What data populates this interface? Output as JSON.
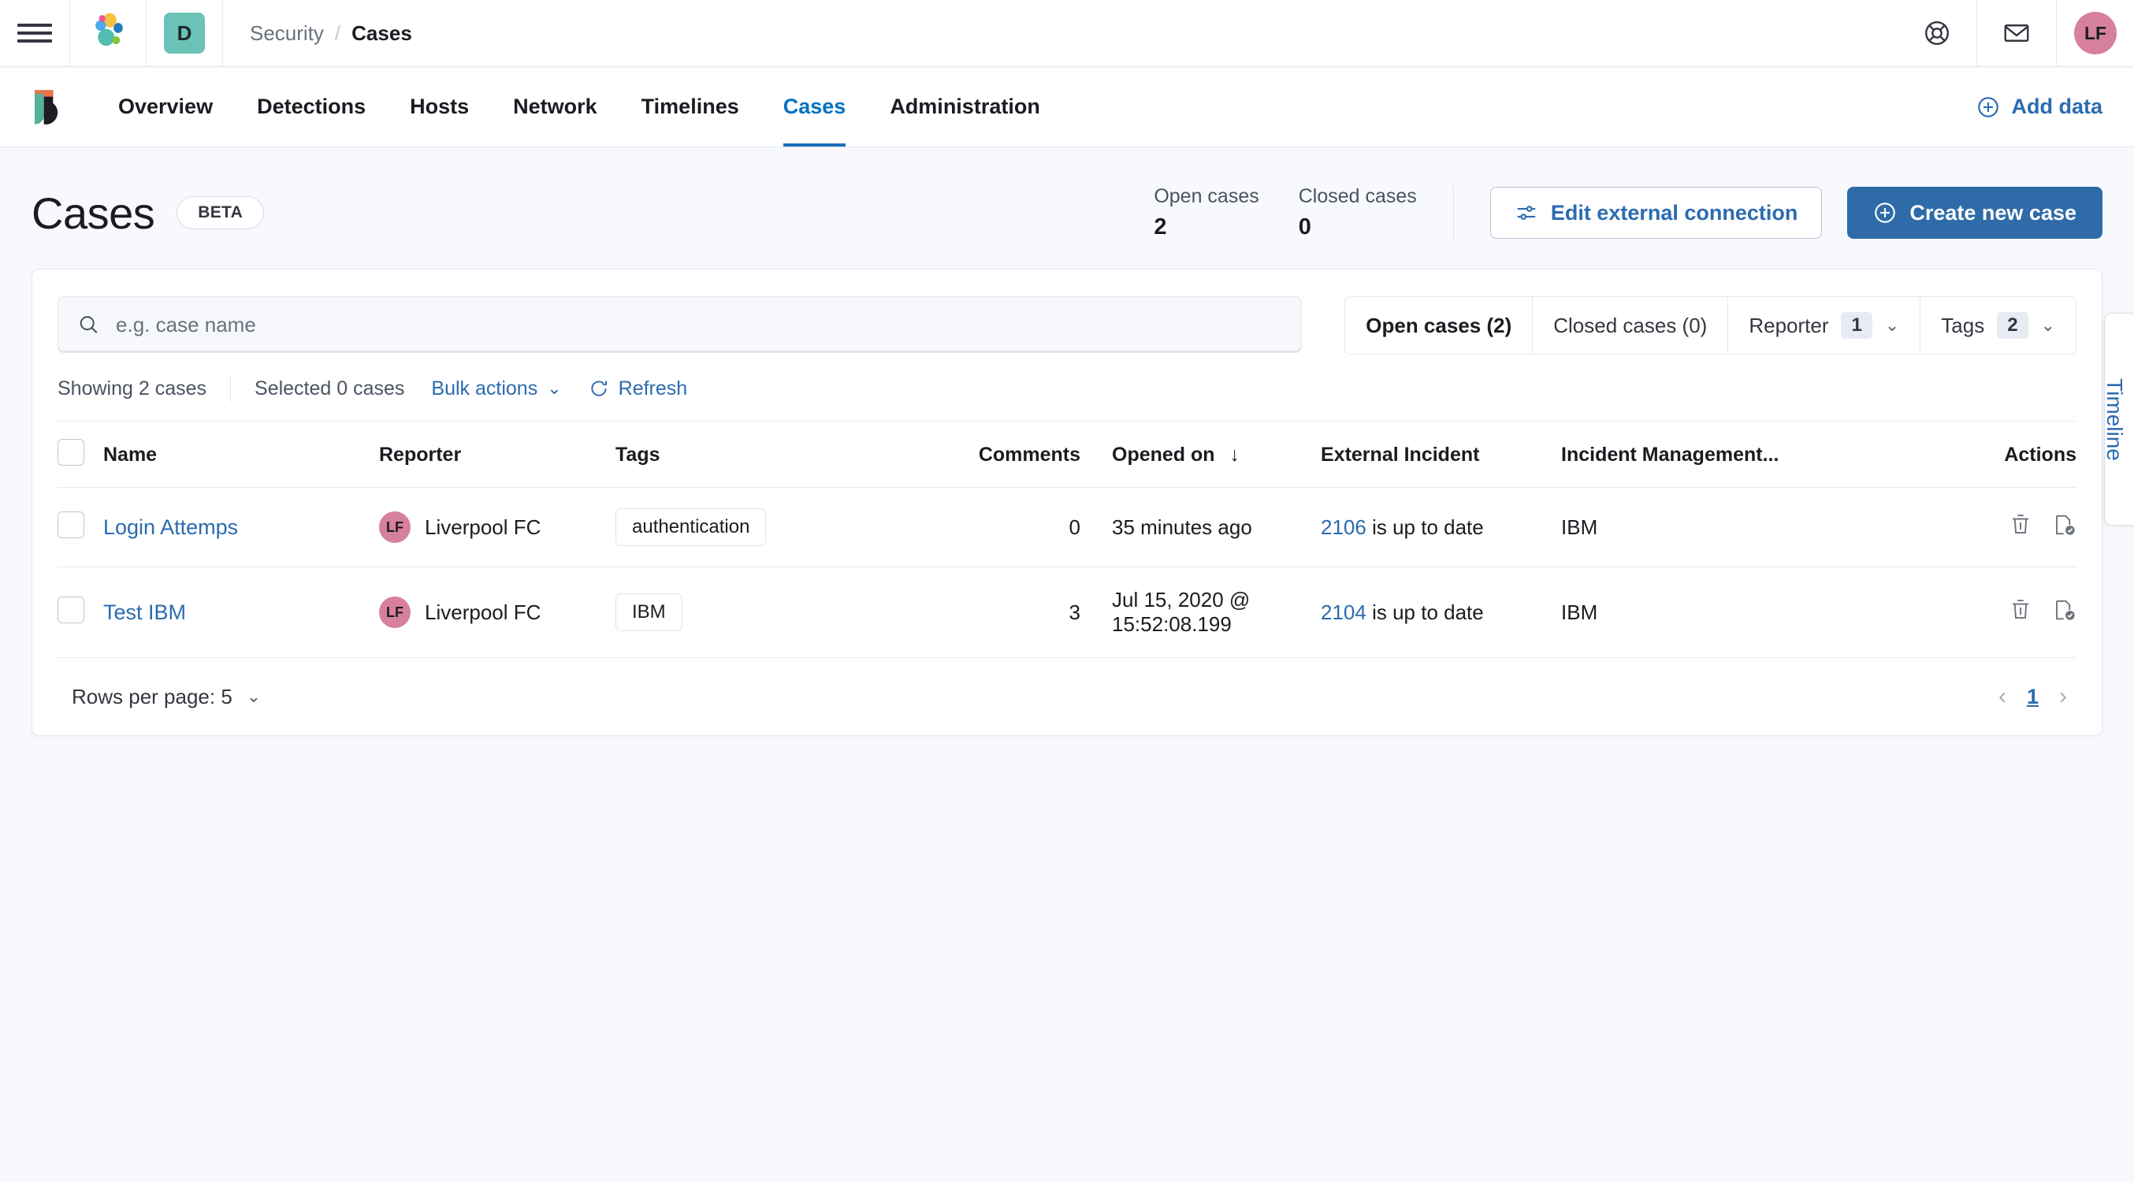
{
  "chrome": {
    "menu_icon": "hamburger-icon",
    "elastic_logo": "elastic-logo",
    "space_initial": "D",
    "breadcrumbs": [
      "Security",
      "Cases"
    ],
    "breadcrumb_separator": "/",
    "help_icon": "life-ring-icon",
    "mail_icon": "mail-icon",
    "user_initials": "LF"
  },
  "app_nav": {
    "logo": "security-shield-logo",
    "items": [
      {
        "label": "Overview",
        "active": false
      },
      {
        "label": "Detections",
        "active": false
      },
      {
        "label": "Hosts",
        "active": false
      },
      {
        "label": "Network",
        "active": false
      },
      {
        "label": "Timelines",
        "active": false
      },
      {
        "label": "Cases",
        "active": true
      },
      {
        "label": "Administration",
        "active": false
      }
    ],
    "add_data_label": "Add data",
    "add_data_icon": "plus-circle-icon"
  },
  "header": {
    "title": "Cases",
    "badge": "BETA",
    "stats": [
      {
        "label": "Open cases",
        "value": "2"
      },
      {
        "label": "Closed cases",
        "value": "0"
      }
    ],
    "edit_connection_label": "Edit external connection",
    "edit_connection_icon": "controls-icon",
    "create_case_label": "Create new case",
    "create_case_icon": "plus-circle-icon"
  },
  "search": {
    "placeholder": "e.g. case name",
    "value": "",
    "icon": "search-icon"
  },
  "filters": [
    {
      "label": "Open cases (2)",
      "selected": true,
      "count": null
    },
    {
      "label": "Closed cases (0)",
      "selected": false,
      "count": null
    },
    {
      "label": "Reporter",
      "selected": false,
      "count": "1"
    },
    {
      "label": "Tags",
      "selected": false,
      "count": "2"
    }
  ],
  "toolbar": {
    "showing": "Showing 2 cases",
    "selected": "Selected 0 cases",
    "bulk_actions": "Bulk actions",
    "refresh": "Refresh",
    "refresh_icon": "refresh-icon",
    "chevron_icon": "chevron-down-icon"
  },
  "table": {
    "columns": [
      "Name",
      "Reporter",
      "Tags",
      "Comments",
      "Opened on",
      "External Incident",
      "Incident Management...",
      "Actions"
    ],
    "sort_column": "Opened on",
    "sort_icon": "arrow-down-icon",
    "rows": [
      {
        "name": "Login Attemps",
        "reporter": "Liverpool FC",
        "reporter_initials": "LF",
        "tags": [
          "authentication"
        ],
        "comments": "0",
        "opened_on": "35 minutes ago",
        "external_incident_id": "2106",
        "external_incident_status": "is up to date",
        "incident_management": "IBM",
        "actions": [
          "trash-icon",
          "case-check-icon"
        ]
      },
      {
        "name": "Test IBM",
        "reporter": "Liverpool FC",
        "reporter_initials": "LF",
        "tags": [
          "IBM"
        ],
        "comments": "3",
        "opened_on": "Jul 15, 2020 @ 15:52:08.199",
        "external_incident_id": "2104",
        "external_incident_status": "is up to date",
        "incident_management": "IBM",
        "actions": [
          "trash-icon",
          "case-check-icon"
        ]
      }
    ]
  },
  "footer": {
    "rows_per_page": "Rows per page: 5",
    "prev_icon": "chevron-left-icon",
    "next_icon": "chevron-right-icon",
    "current_page": "1"
  },
  "timeline": {
    "label": "Timeline",
    "chevron_icon": "chevron-left-icon"
  },
  "colors": {
    "accent_link": "#2b6bb0",
    "primary_button": "#2e6ba8",
    "avatar_pink": "#d6809c",
    "space_teal": "#6bc2b6",
    "page_bg": "#f8f9fc"
  }
}
